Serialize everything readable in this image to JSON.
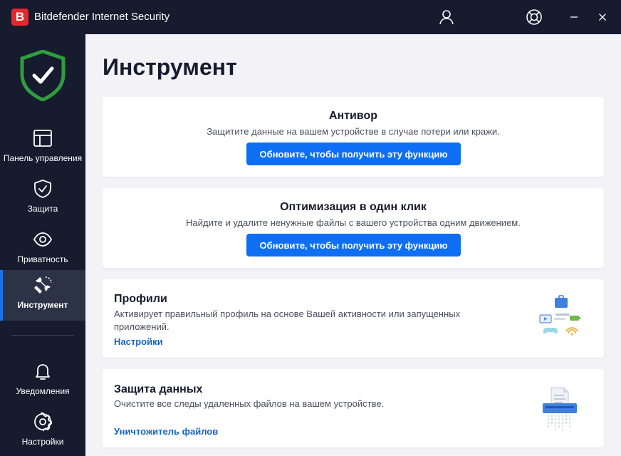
{
  "window": {
    "logo_letter": "B",
    "title": "Bitdefender Internet Security",
    "minimize": "—",
    "close": "✕"
  },
  "sidebar": {
    "items": [
      {
        "label": "Панель управления",
        "icon": "dashboard-icon"
      },
      {
        "label": "Защита",
        "icon": "shield-check-icon"
      },
      {
        "label": "Приватность",
        "icon": "eye-icon"
      },
      {
        "label": "Инструмент",
        "icon": "utilities-icon",
        "active": true
      },
      {
        "label": "Уведомления",
        "icon": "bell-icon"
      },
      {
        "label": "Настройки",
        "icon": "gear-icon"
      }
    ]
  },
  "main": {
    "title": "Инструмент",
    "cards": [
      {
        "title": "Антивор",
        "description": "Защитите данные на вашем устройстве в случае потери или кражи.",
        "button": "Обновите, чтобы получить эту функцию"
      },
      {
        "title": "Оптимизация в один клик",
        "description": "Найдите и удалите ненужные файлы с вашего устройства одним движением.",
        "button": "Обновите, чтобы получить эту функцию"
      },
      {
        "title": "Профили",
        "description_line1": "Активирует правильный профиль на основе Вашей активности или запущенных",
        "description_line2": "приложений.",
        "link": "Настройки",
        "illustration": "profiles-illustration"
      },
      {
        "title": "Защита данных",
        "description": "Очистите все следы удаленных файлов на вашем устройстве.",
        "link": "Уничтожитель файлов",
        "illustration": "file-shredder-illustration"
      }
    ]
  },
  "colors": {
    "sidebar_bg": "#161b2e",
    "accent": "#0e6ff5",
    "shield_green": "#2e9d3f",
    "brand_red": "#e3282e",
    "link": "#1465c9"
  }
}
